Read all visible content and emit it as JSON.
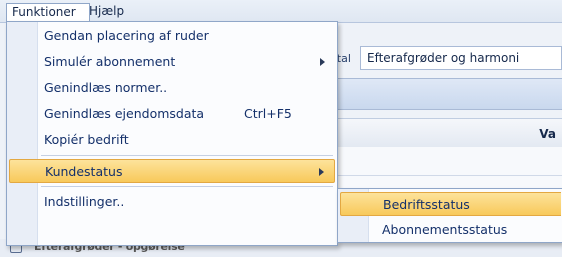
{
  "menubar": {
    "items": [
      {
        "label": "Funktioner"
      },
      {
        "label": "Hjælp"
      }
    ]
  },
  "background": {
    "field_label": "etal",
    "field_value": "Efterafgrøder og harmoni",
    "column_header": "Va",
    "bottom_row_text": "Efterafgrøder - opgørelse"
  },
  "menu": {
    "items": [
      {
        "label": "Gendan placering af ruder",
        "shortcut": ""
      },
      {
        "label": "Simulér abonnement",
        "shortcut": "",
        "submenu": true
      },
      {
        "label": "Genindlæs normer..",
        "shortcut": ""
      },
      {
        "label": "Genindlæs ejendomsdata",
        "shortcut": "Ctrl+F5"
      },
      {
        "label": "Kopiér bedrift",
        "shortcut": ""
      },
      {
        "label": "Kundestatus",
        "shortcut": "",
        "submenu": true,
        "highlighted": true
      },
      {
        "label": "Indstillinger..",
        "shortcut": ""
      }
    ]
  },
  "submenu": {
    "items": [
      {
        "label": "Bedriftsstatus",
        "highlighted": true
      },
      {
        "label": "Abonnementsstatus"
      }
    ]
  }
}
